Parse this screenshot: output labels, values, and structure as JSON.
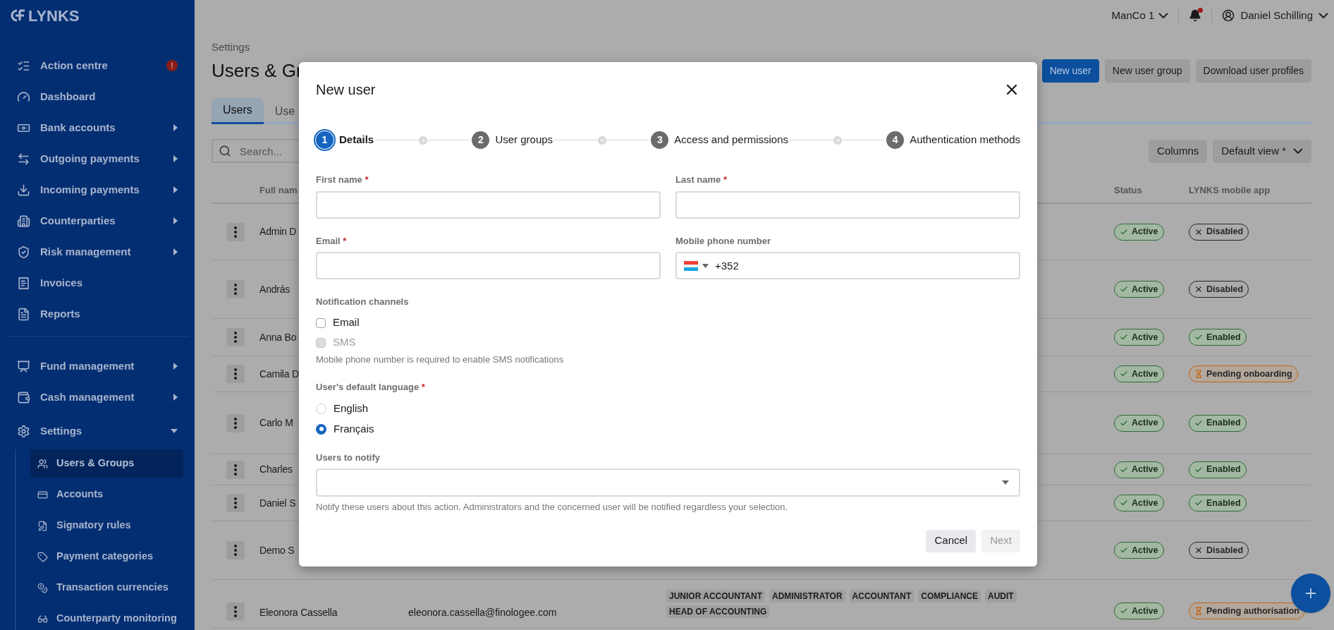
{
  "header": {
    "org": "ManCo 1",
    "user": "Daniel Schilling",
    "notification_dot": true
  },
  "sidebar": {
    "logo": "LYNKS",
    "sections": [
      [
        {
          "label": "Action centre",
          "alert": "!",
          "expandable": false
        },
        {
          "label": "Dashboard",
          "expandable": false
        },
        {
          "label": "Bank accounts",
          "expandable": true
        },
        {
          "label": "Outgoing payments",
          "expandable": true
        },
        {
          "label": "Incoming payments",
          "expandable": true
        },
        {
          "label": "Counterparties",
          "expandable": true
        },
        {
          "label": "Risk management",
          "expandable": true
        },
        {
          "label": "Invoices",
          "expandable": false
        },
        {
          "label": "Reports",
          "expandable": false
        }
      ],
      [
        {
          "label": "Fund management",
          "expandable": true
        },
        {
          "label": "Cash management",
          "expandable": true
        },
        {
          "label": "Settings",
          "expandable": true,
          "expanded": true,
          "children": [
            {
              "label": "Users & Groups",
              "selected": true
            },
            {
              "label": "Accounts",
              "selected": false
            },
            {
              "label": "Signatory rules",
              "selected": false
            },
            {
              "label": "Payment categories",
              "selected": false
            },
            {
              "label": "Transaction currencies",
              "selected": false
            },
            {
              "label": "Counterparty monitoring",
              "selected": false
            }
          ]
        }
      ]
    ]
  },
  "page": {
    "breadcrumb": "Settings",
    "title": "Users & Gr",
    "actions": [
      {
        "label": "New user",
        "kind": "primary"
      },
      {
        "label": "New user group",
        "kind": "secondary"
      },
      {
        "label": "Download user profiles",
        "kind": "secondary"
      }
    ],
    "tabs": [
      {
        "label": "Users",
        "selected": true
      },
      {
        "label": "Use",
        "selected": false
      }
    ],
    "search": {
      "placeholder": "Search..."
    },
    "view_buttons": [
      {
        "label": "Columns",
        "dropdown": false
      },
      {
        "label": "Default view *",
        "dropdown": true
      }
    ],
    "table": {
      "columns": [
        "Full nam",
        "Status",
        "LYNKS mobile app"
      ],
      "rows": [
        {
          "name": "Admin D",
          "status": {
            "label": "Active",
            "kind": "success"
          },
          "app": {
            "label": "Disabled",
            "kind": "disabled"
          }
        },
        {
          "name": "András",
          "status": {
            "label": "Active",
            "kind": "success"
          },
          "app": {
            "label": "Disabled",
            "kind": "disabled"
          }
        },
        {
          "name": "Anna Bo",
          "status": {
            "label": "Active",
            "kind": "success"
          },
          "app": {
            "label": "Enabled",
            "kind": "success"
          }
        },
        {
          "name": "Camila D",
          "status": {
            "label": "Active",
            "kind": "success"
          },
          "app": {
            "label": "Pending onboarding",
            "kind": "pending"
          }
        },
        {
          "name": "Carlo M",
          "status": {
            "label": "Active",
            "kind": "success"
          },
          "app": {
            "label": "Enabled",
            "kind": "success"
          }
        },
        {
          "name": "Charles",
          "status": {
            "label": "Active",
            "kind": "success"
          },
          "app": {
            "label": "Enabled",
            "kind": "success"
          }
        },
        {
          "name": "Daniel S",
          "status": {
            "label": "Active",
            "kind": "success"
          },
          "app": {
            "label": "Enabled",
            "kind": "success"
          }
        },
        {
          "name": "Demo S",
          "status": {
            "label": "Active",
            "kind": "success"
          },
          "app": {
            "label": "Disabled",
            "kind": "disabled"
          }
        },
        {
          "name": "Eleonora Cassella",
          "email": "eleonora.cassella@finologee.com",
          "groups": [
            "JUNIOR ACCOUNTANT",
            "ADMINISTRATOR",
            "ACCOUNTANT",
            "COMPLIANCE",
            "AUDIT",
            "HEAD OF ACCOUNTING"
          ],
          "status": {
            "label": "Active",
            "kind": "success"
          },
          "app": {
            "label": "Pending authorisation",
            "kind": "pending"
          }
        }
      ]
    }
  },
  "modal": {
    "title": "New user",
    "required_mark": "*",
    "steps": [
      {
        "number": "1",
        "label": "Details",
        "selected": true
      },
      {
        "number": "2",
        "label": "User groups",
        "selected": false
      },
      {
        "number": "3",
        "label": "Access and permissions",
        "selected": false
      },
      {
        "number": "4",
        "label": "Authentication methods",
        "selected": false
      }
    ],
    "fields": [
      {
        "label": "First name",
        "required": true
      },
      {
        "label": "Last name",
        "required": true
      },
      {
        "label": "Email",
        "required": true
      },
      {
        "label": "Mobile phone number",
        "required": false,
        "kind": "phone",
        "value": "+352"
      }
    ],
    "notification_channels": {
      "label": "Notification channels",
      "options": [
        {
          "label": "Email",
          "checked": false,
          "disabled": false
        },
        {
          "label": "SMS",
          "checked": false,
          "disabled": true
        }
      ],
      "hint": "Mobile phone number is required to enable SMS notifications"
    },
    "language": {
      "label": "User's default language",
      "required": true,
      "options": [
        {
          "label": "English",
          "selected": false
        },
        {
          "label": "Français",
          "selected": true
        }
      ]
    },
    "users_to_notify": {
      "label": "Users to notify",
      "hint": "Notify these users about this action. Administrators and the concerned user will be notified regardless your selection."
    },
    "buttons": [
      {
        "label": "Cancel",
        "disabled": false
      },
      {
        "label": "Next",
        "disabled": true
      }
    ]
  }
}
